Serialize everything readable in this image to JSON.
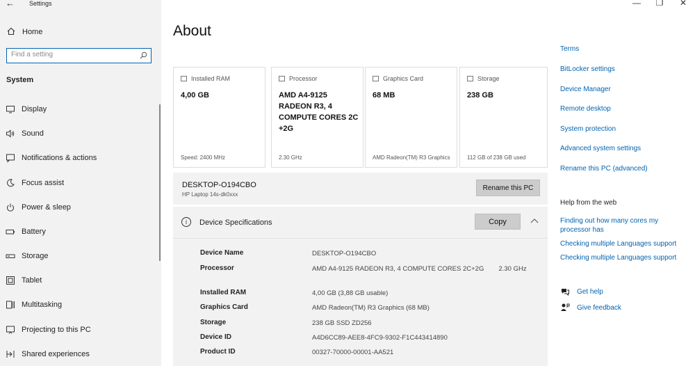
{
  "window": {
    "title": "Settings",
    "minimize_glyph": "—",
    "maximize_glyph": "❐",
    "close_glyph": "✕",
    "back_glyph": "←"
  },
  "sidebar": {
    "home_label": "Home",
    "search_placeholder": "Find a setting",
    "section_label": "System",
    "items": [
      {
        "label": "Display",
        "icon": "display-icon"
      },
      {
        "label": "Sound",
        "icon": "sound-icon"
      },
      {
        "label": "Notifications & actions",
        "icon": "notifications-icon"
      },
      {
        "label": "Focus assist",
        "icon": "moon-icon"
      },
      {
        "label": "Power & sleep",
        "icon": "power-icon"
      },
      {
        "label": "Battery",
        "icon": "battery-icon"
      },
      {
        "label": "Storage",
        "icon": "storage-icon"
      },
      {
        "label": "Tablet",
        "icon": "tablet-icon"
      },
      {
        "label": "Multitasking",
        "icon": "multitasking-icon"
      },
      {
        "label": "Projecting to this PC",
        "icon": "projector-icon"
      },
      {
        "label": "Shared experiences",
        "icon": "shared-icon"
      }
    ]
  },
  "main": {
    "title": "About",
    "cards": [
      {
        "head": "Installed RAM",
        "value": "4,00 GB",
        "foot": "Speed: 2400 MHz"
      },
      {
        "head": "Processor",
        "value": "AMD A4-9125 RADEON R3, 4 COMPUTE CORES 2C +2G",
        "foot": "2.30 GHz"
      },
      {
        "head": "Graphics Card",
        "value": "68 MB",
        "foot": "AMD Radeon(TM) R3 Graphics"
      },
      {
        "head": "Storage",
        "value": "238 GB",
        "foot": "112 GB of 238 GB used"
      }
    ],
    "pc_name": "DESKTOP-O194CBO",
    "pc_model": "HP Laptop 14s-dk0xxx",
    "rename_label": "Rename this PC",
    "spec_title": "Device Specifications",
    "copy_label": "Copy",
    "specs": [
      {
        "key": "Device Name",
        "value": "DESKTOP-O194CBO"
      },
      {
        "key": "Processor",
        "value": "AMD A4-9125 RADEON R3, 4 COMPUTE CORES 2C+2G        2.30 GHz"
      },
      {
        "key": "Installed RAM",
        "value": "4,00 GB (3,88 GB usable)"
      },
      {
        "key": "Graphics Card",
        "value": "AMD Radeon(TM) R3 Graphics (68 MB)"
      },
      {
        "key": "Storage",
        "value": "238 GB SSD ZD256"
      },
      {
        "key": "Device ID",
        "value": "A4D6CC89-AEE8-4FC9-9302-F1C443414890"
      },
      {
        "key": "Product ID",
        "value": "00327-70000-00001-AA521"
      }
    ]
  },
  "right": {
    "links": [
      "Terms",
      "BitLocker settings",
      "Device Manager",
      "Remote desktop",
      "System protection",
      "Advanced system settings",
      "Rename this PC (advanced)"
    ],
    "help_heading": "Help from the web",
    "web_links": [
      "Finding out how many cores my",
      "processor has",
      "Checking multiple Languages support",
      "Checking multiple Languages support"
    ],
    "get_help": "Get help",
    "give_feedback": "Give feedback"
  },
  "colors": {
    "accent": "#0063b1",
    "sidebar_bg": "#f2f2f2",
    "button_bg": "#cccccc"
  }
}
